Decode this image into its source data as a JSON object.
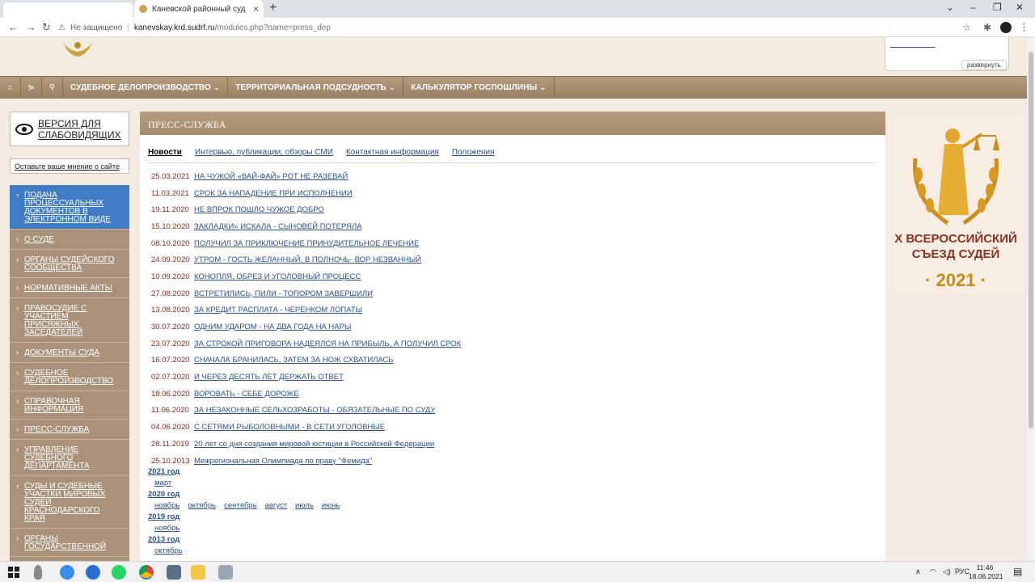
{
  "browser": {
    "tab_title": "Каневской районный суд Крас",
    "url_security": "Не защищено",
    "url_host": "kanevskay.krd.sudrf.ru",
    "url_path": "/modules.php?name=press_dep"
  },
  "header": {
    "font_widget_toggle": "развернуть",
    "font_widget_links": "_____ _______"
  },
  "main_menu": [
    {
      "label": "СУДЕБНОЕ ДЕЛОПРОИЗВОДСТВО ⌄"
    },
    {
      "label": "ТЕРРИТОРИАЛЬНАЯ ПОДСУДНОСТЬ ⌄"
    },
    {
      "label": "КАЛЬКУЛЯТОР ГОСПОШЛИНЫ ⌄"
    }
  ],
  "sidebar": {
    "vision_label_line1": "ВЕРСИЯ ДЛЯ",
    "vision_label_line2": "СЛАБОВИДЯЩИХ",
    "opinion_label": "Оставьте ваше мнение о сайте",
    "items": [
      {
        "label": "ПОДАЧА ПРОЦЕССУАЛЬНЫХ ДОКУМЕНТОВ В ЭЛЕКТРОННОМ ВИДЕ"
      },
      {
        "label": "О СУДЕ"
      },
      {
        "label": "ОРГАНЫ СУДЕЙСКОГО СООБЩЕСТВА"
      },
      {
        "label": "НОРМАТИВНЫЕ АКТЫ"
      },
      {
        "label": "ПРАВОСУДИЕ С УЧАСТИЕМ ПРИСЯЖНЫХ ЗАСЕДАТЕЛЕЙ"
      },
      {
        "label": "ДОКУМЕНТЫ СУДА"
      },
      {
        "label": "СУДЕБНОЕ ДЕЛОПРОИЗВОДСТВО"
      },
      {
        "label": "СПРАВОЧНАЯ ИНФОРМАЦИЯ"
      },
      {
        "label": "ПРЕСС-СЛУЖБА"
      },
      {
        "label": "УПРАВЛЕНИЕ СУДЕБНОГО ДЕПАРТАМЕНТА"
      },
      {
        "label": "СУДЫ И СУДЕБНЫЕ УЧАСТКИ МИРОВЫХ СУДЕЙ КРАСНОДАРСКОГО КРАЯ"
      },
      {
        "label": "ОРГАНЫ ГОСУДАРСТВЕННОЙ"
      }
    ]
  },
  "content": {
    "title": "ПРЕСС-СЛУЖБА",
    "tabs": [
      {
        "label": "Новости"
      },
      {
        "label": "Интервью, публикации, обзоры СМИ"
      },
      {
        "label": "Контактная информация"
      },
      {
        "label": "Положения"
      }
    ],
    "news": [
      {
        "date": "25.03.2021",
        "title": "НА ЧУЖОЙ «ВАЙ-ФАЙ» РОТ НЕ РАЗЕВАЙ"
      },
      {
        "date": "11.03.2021",
        "title": "СРОК ЗА НАПАДЕНИЕ ПРИ ИСПОЛНЕНИИ"
      },
      {
        "date": "19.11.2020",
        "title": "НЕ ВПРОК ПОШЛО ЧУЖОЕ ДОБРО"
      },
      {
        "date": "15.10.2020",
        "title": "ЗАКЛАДКИ» ИСКАЛА - СЫНОВЕЙ ПОТЕРЯЛА"
      },
      {
        "date": "08.10.2020",
        "title": "ПОЛУЧИЛ ЗА ПРИКЛЮЧЕНИЕ ПРИНУДИТЕЛЬНОЕ ЛЕЧЕНИЕ"
      },
      {
        "date": "24.09.2020",
        "title": "УТРОМ - ГОСТЬ ЖЕЛАННЫЙ, В ПОЛНОЧЬ- ВОР НЕЗВАННЫЙ"
      },
      {
        "date": "10.09.2020",
        "title": "КОНОПЛЯ, ОБРЕЗ И УГОЛОВНЫЙ ПРОЦЕСС"
      },
      {
        "date": "27.08.2020",
        "title": "ВСТРЕТИЛИСЬ, ПИЛИ - ТОПОРОМ ЗАВЕРШИЛИ"
      },
      {
        "date": "13.08.2020",
        "title": "ЗА КРЕДИТ РАСПЛАТА - ЧЕРЕНКОМ ЛОПАТЫ"
      },
      {
        "date": "30.07.2020",
        "title": "ОДНИМ УДАРОМ - НА ДВА ГОДА НА НАРЫ"
      },
      {
        "date": "23.07.2020",
        "title": "ЗА СТРОКОЙ ПРИГОВОРА НАДЕЯЛСЯ НА ПРИБЫЛЬ, А ПОЛУЧИЛ СРОК"
      },
      {
        "date": "16.07.2020",
        "title": "СНАЧАЛА БРАНИЛАСЬ, ЗАТЕМ ЗА НОЖ СХВАТИЛАСЬ"
      },
      {
        "date": "02.07.2020",
        "title": "И ЧЕРЕЗ ДЕСЯТЬ ЛЕТ ДЕРЖАТЬ ОТВЕТ"
      },
      {
        "date": "18.06.2020",
        "title": "ВОРОВАТЬ - СЕБЕ ДОРОЖЕ"
      },
      {
        "date": "11.06.2020",
        "title": "ЗА НЕЗАКОННЫЕ СЕЛЬХОЗРАБОТЫ - ОБЯЗАТЕЛЬНЫЕ ПО СУДУ"
      },
      {
        "date": "04.06.2020",
        "title": "С СЕТЯМИ РЫБОЛОВНЫМИ - В СЕТИ УГОЛОВНЫЕ"
      },
      {
        "date": "28.11.2019",
        "title": "20 лет со дня создания мировой юстиции в Российской Федерации"
      },
      {
        "date": "25.10.2013",
        "title": "Межрегиональная Олимпиада по праву \"Фемида\""
      }
    ],
    "archive": [
      {
        "year": "2021 год",
        "months": [
          "март"
        ]
      },
      {
        "year": "2020 год",
        "months": [
          "ноябрь",
          "октябрь",
          "сентябрь",
          "август",
          "июль",
          "июнь"
        ]
      },
      {
        "year": "2019 год",
        "months": [
          "ноябрь"
        ]
      },
      {
        "year": "2013 год",
        "months": [
          "октябрь"
        ]
      }
    ]
  },
  "banner": {
    "line1": "X ВСЕРОССИЙСКИЙ",
    "line2": "СЪЕЗД СУДЕЙ",
    "year": "· 2021 ·"
  },
  "taskbar": {
    "lang": "РУС",
    "time": "11:46",
    "date": "18.06.2021",
    "notif_count": "2"
  }
}
